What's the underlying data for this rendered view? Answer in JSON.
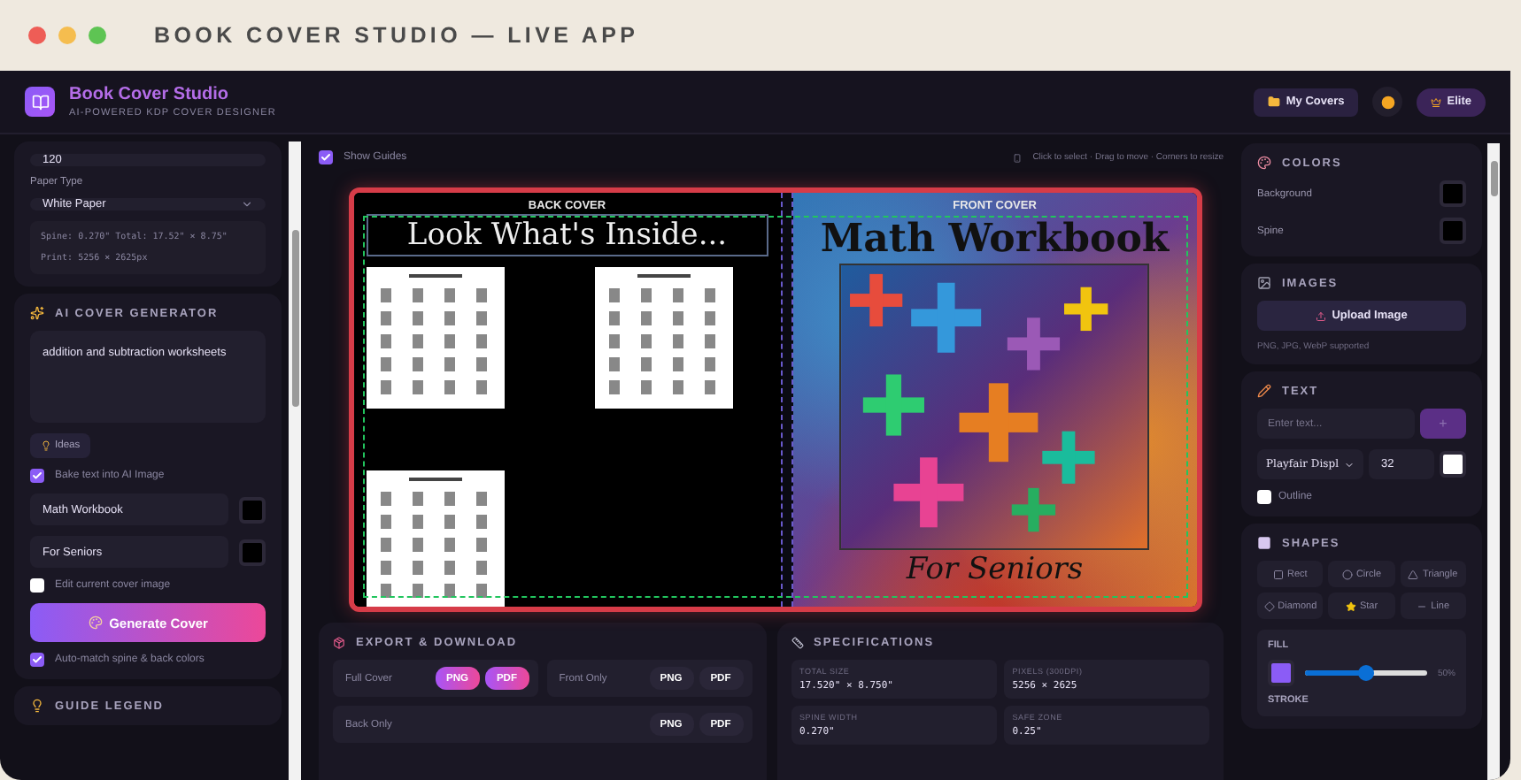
{
  "window": {
    "title": "BOOK COVER STUDIO — LIVE APP"
  },
  "header": {
    "title": "Book Cover Studio",
    "subtitle": "AI-POWERED KDP COVER DESIGNER",
    "buttons": [
      {
        "kind": "covers",
        "label": "My Covers"
      },
      {
        "kind": "theme"
      },
      {
        "kind": "plan",
        "label": "Elite"
      }
    ]
  },
  "left_panel": {
    "page_count": "120",
    "paper_type_label": "Paper Type",
    "paper_type": "White Paper",
    "spine_info": "Spine: 0.270\"  Total: 17.52\" × 8.75\"",
    "print_info": "Print: 5256 × 2625px",
    "ai": {
      "title": "AI COVER GENERATOR",
      "prompt": "addition and subtraction worksheets",
      "ideas": "Ideas",
      "bake_text": {
        "label": "Bake text into AI Image",
        "checked": true
      },
      "fields": [
        {
          "value": "Math Workbook"
        },
        {
          "value": "For Seniors"
        }
      ],
      "edit_current": {
        "label": "Edit current cover image",
        "checked": false
      },
      "generate": "Generate Cover",
      "auto_match": {
        "label": "Auto-match spine & back colors",
        "checked": true
      }
    },
    "guide_legend": "GUIDE LEGEND"
  },
  "canvas": {
    "show_guides": {
      "label": "Show Guides",
      "checked": true
    },
    "hint": "Click to select · Drag to move · Corners to resize",
    "back": {
      "label": "BACK COVER",
      "heading": "Look What's Inside..."
    },
    "front": {
      "label": "FRONT COVER",
      "title": "Math Workbook",
      "subtitle": "For Seniors"
    }
  },
  "export": {
    "title": "EXPORT & DOWNLOAD",
    "rows": [
      {
        "label": "Full Cover",
        "formats": [
          {
            "label": "PNG",
            "selected": true
          },
          {
            "label": "PDF",
            "selected": true
          }
        ]
      },
      {
        "label": "Front Only",
        "formats": [
          {
            "label": "PNG",
            "selected": false
          },
          {
            "label": "PDF",
            "selected": false
          }
        ]
      },
      {
        "label": "Back Only",
        "formats": [
          {
            "label": "PNG",
            "selected": false
          },
          {
            "label": "PDF",
            "selected": false
          }
        ]
      }
    ]
  },
  "specifications": {
    "title": "SPECIFICATIONS",
    "items": [
      {
        "label": "TOTAL SIZE",
        "value": "17.520\" × 8.750\""
      },
      {
        "label": "PIXELS (300DPI)",
        "value": "5256 × 2625"
      },
      {
        "label": "SPINE WIDTH",
        "value": "0.270\""
      },
      {
        "label": "SAFE ZONE",
        "value": "0.25\""
      }
    ]
  },
  "right_panel": {
    "colors": {
      "title": "COLORS",
      "items": [
        {
          "label": "Background"
        },
        {
          "label": "Spine"
        }
      ]
    },
    "images": {
      "title": "IMAGES",
      "button": "Upload Image",
      "hint": "PNG, JPG, WebP supported"
    },
    "text": {
      "title": "TEXT",
      "placeholder": "Enter text...",
      "add": "+",
      "font": "Playfair Displ",
      "size": "32",
      "outline": {
        "label": "Outline",
        "checked": false
      }
    },
    "shapes": {
      "title": "SHAPES",
      "items": [
        {
          "kind": "rect",
          "label": "Rect"
        },
        {
          "kind": "circle",
          "label": "Circle"
        },
        {
          "kind": "triangle",
          "label": "Triangle"
        },
        {
          "kind": "diamond",
          "label": "Diamond"
        },
        {
          "kind": "star",
          "label": "Star"
        },
        {
          "kind": "line",
          "label": "Line"
        }
      ],
      "fill": {
        "label": "FILL",
        "level": 0.5,
        "reading": "50%"
      },
      "stroke_label": "STROKE"
    }
  }
}
